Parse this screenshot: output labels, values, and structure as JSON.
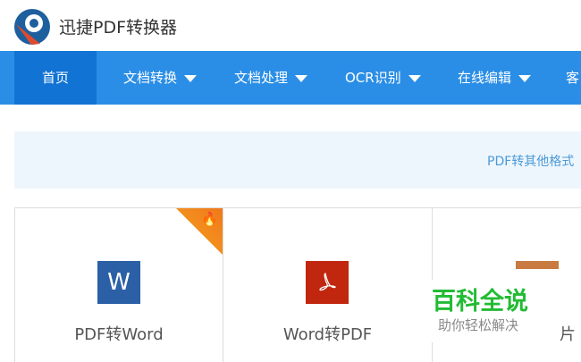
{
  "header": {
    "title": "迅捷PDF转换器"
  },
  "nav": {
    "items": [
      {
        "label": "首页",
        "active": true
      },
      {
        "label": "文档转换"
      },
      {
        "label": "文档处理"
      },
      {
        "label": "OCR识别"
      },
      {
        "label": "在线编辑"
      },
      {
        "label": "客"
      }
    ]
  },
  "banner": {
    "text": "PDF转其他格式"
  },
  "cards": [
    {
      "label": "PDF转Word",
      "icon": "W",
      "hot": true
    },
    {
      "label": "Word转PDF",
      "icon": "pdf-icon"
    },
    {
      "label": "片"
    }
  ],
  "watermark": {
    "title": "百科全说",
    "subtitle": "助你轻松解决"
  },
  "colors": {
    "nav": "#2b8ee6",
    "nav_active": "#1173d4",
    "word": "#2b5fa6",
    "pdf": "#c1270f",
    "hot": "#f0781a"
  }
}
